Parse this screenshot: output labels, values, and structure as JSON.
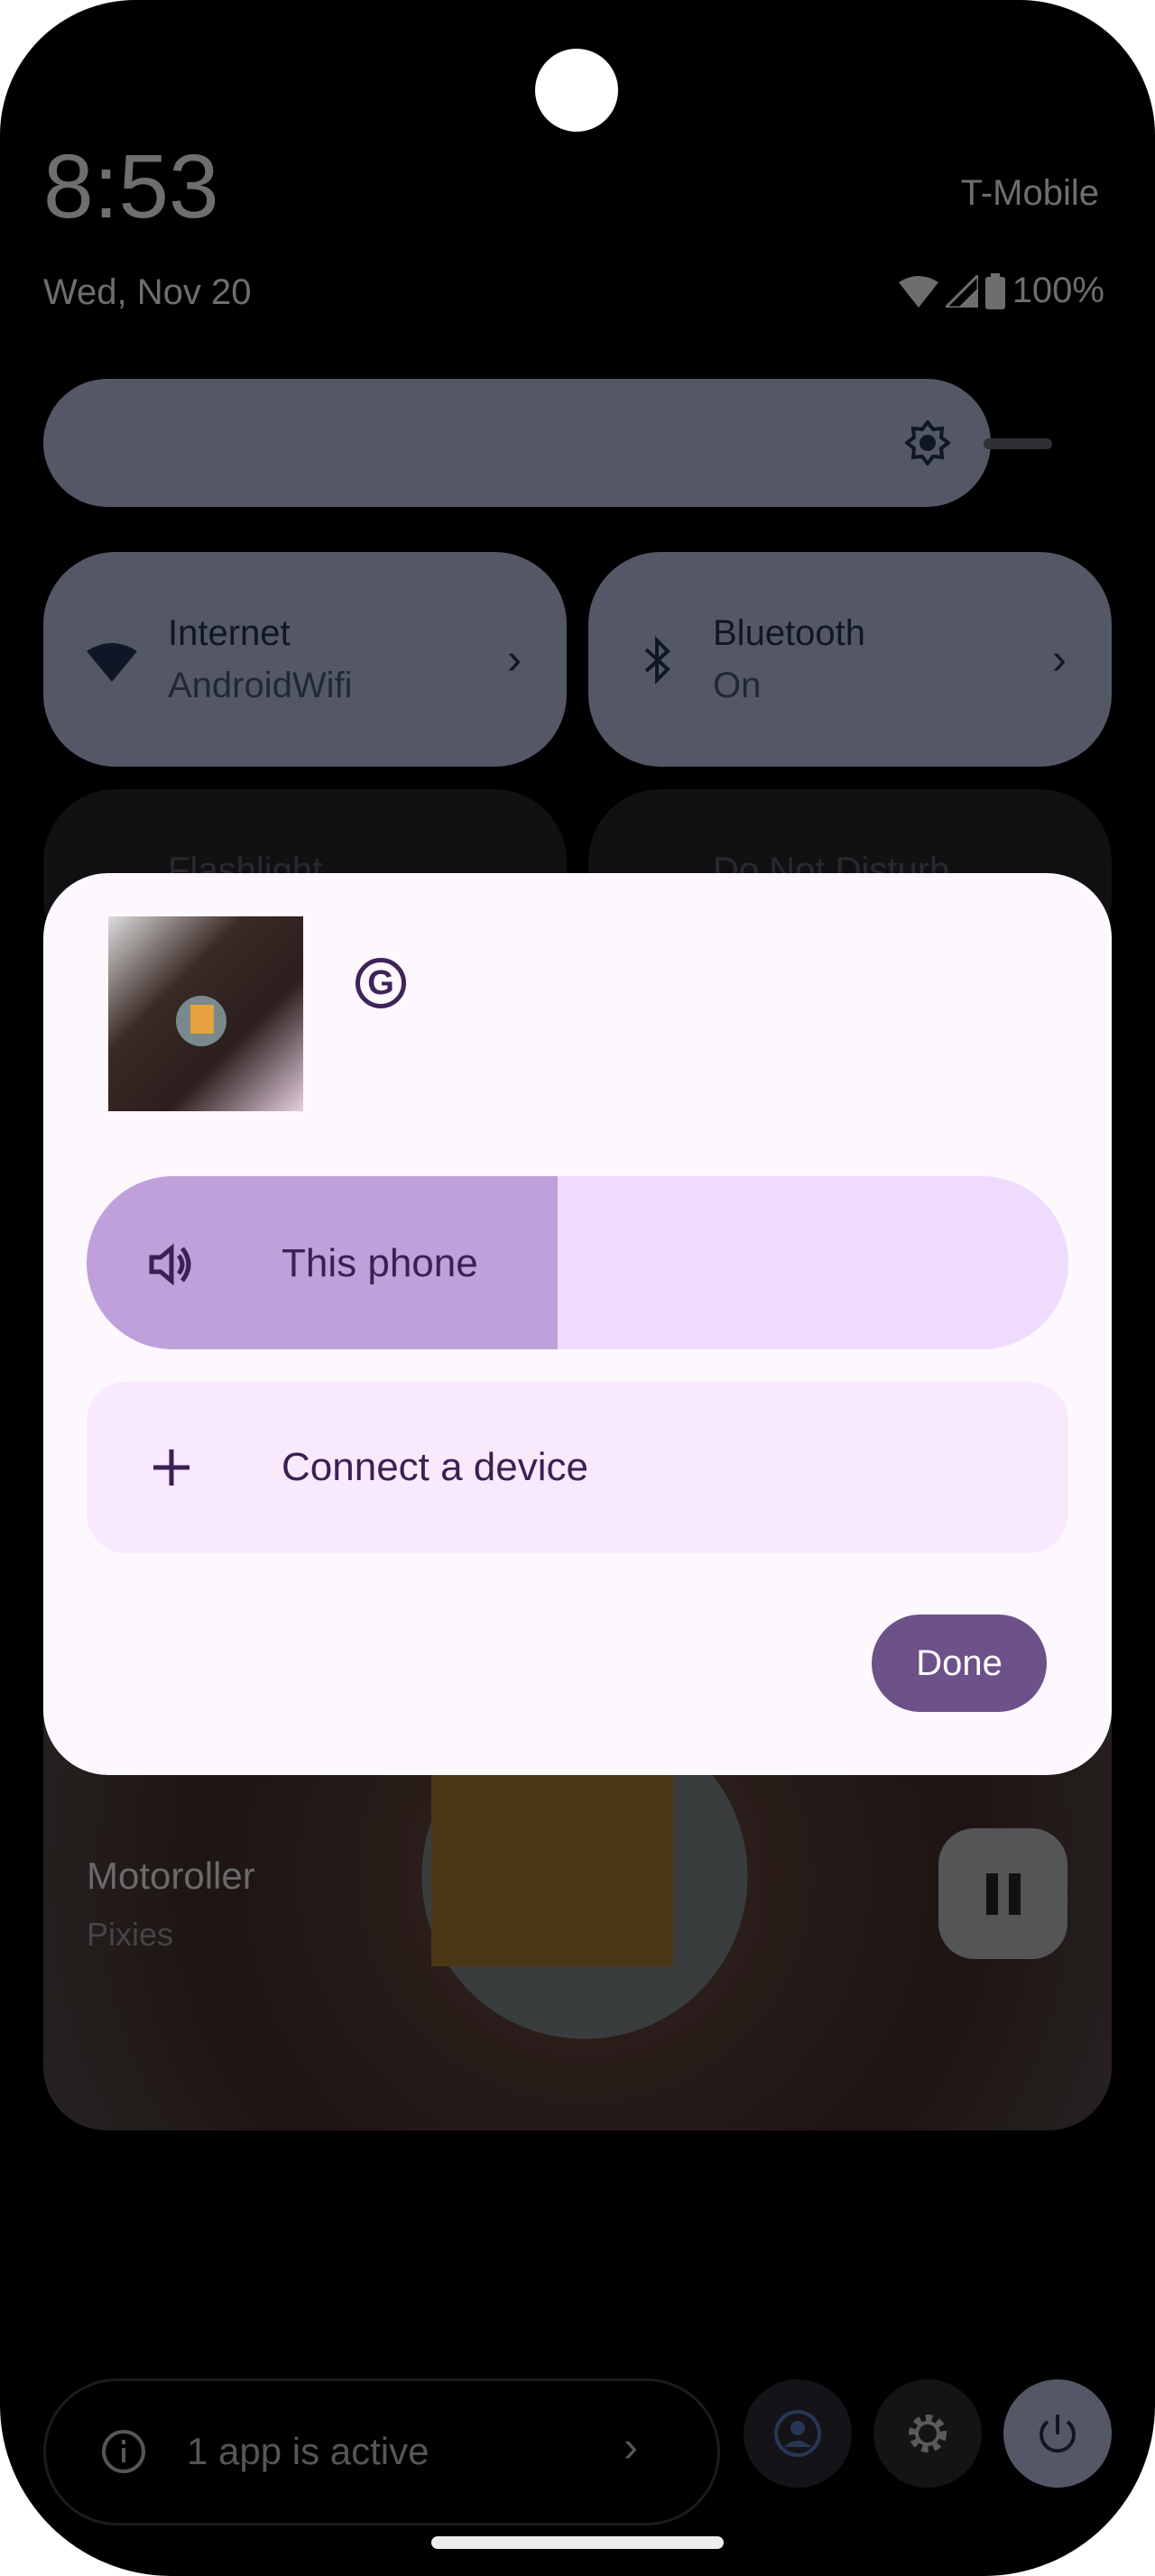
{
  "status_bar": {
    "time": "8:53",
    "date": "Wed, Nov 20",
    "carrier": "T-Mobile",
    "battery": "100%"
  },
  "quick_settings": {
    "brightness_icon": "brightness-icon",
    "tiles": [
      {
        "title": "Internet",
        "subtitle": "AndroidWifi",
        "icon": "wifi-icon"
      },
      {
        "title": "Bluetooth",
        "subtitle": "On",
        "icon": "bluetooth-icon"
      },
      {
        "title": "Flashlight"
      },
      {
        "title": "Do Not Disturb"
      }
    ]
  },
  "media": {
    "title": "Motoroller",
    "artist": "Pixies"
  },
  "output_dialog": {
    "app_icon": "G",
    "devices": [
      {
        "label": "This phone",
        "icon": "speaker-icon",
        "volume_percent": 48
      }
    ],
    "connect_label": "Connect a device",
    "done_label": "Done"
  },
  "footer": {
    "active_apps": "1 app is active"
  },
  "colors": {
    "accent": "#6d5189",
    "slider_fill": "#c0a0da",
    "slider_track": "#efdbfd",
    "dialog_bg": "#fcf8fd"
  }
}
